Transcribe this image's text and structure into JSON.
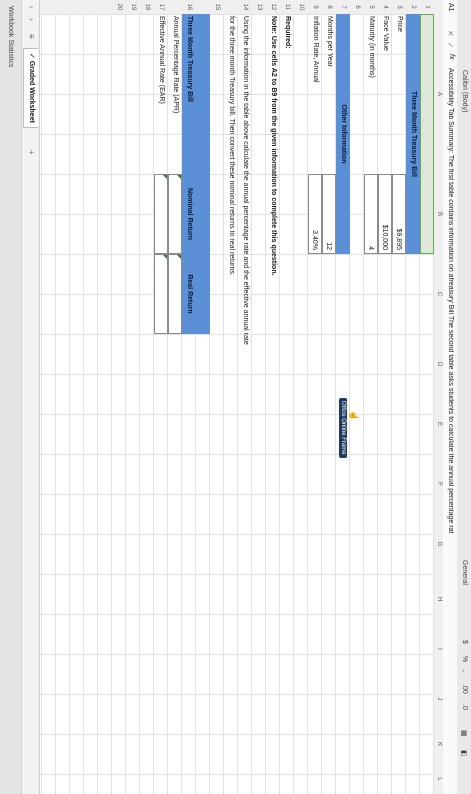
{
  "toolbar": {
    "font_name": "Calibri (Body)",
    "number_format": "General",
    "dollar": "$",
    "percent": "%",
    "comma": ",",
    "decimal_inc": ".00",
    "decimal_dec": ".0"
  },
  "formula_bar": {
    "cell_ref": "A1",
    "fx": "fx",
    "content": "Accessibility Tab Summary: The first table contains information on afreasury Bill The second table asks students to calculate the annual percentage rat"
  },
  "columns": [
    "A",
    "B",
    "C",
    "D",
    "E",
    "F",
    "G",
    "H",
    "I",
    "J",
    "K",
    "L"
  ],
  "rows": [
    "1",
    "2",
    "3",
    "4",
    "5",
    "6",
    "7",
    "8",
    "9",
    "10",
    "11",
    "12",
    "13",
    "14",
    "15",
    "16",
    "17",
    "18",
    "19",
    "20"
  ],
  "table1": {
    "title": "Three Month Treasury Bill",
    "rows": [
      {
        "label": "Price",
        "value": "$9,895"
      },
      {
        "label": "Face Value",
        "value": "$10,000"
      },
      {
        "label": "Maturity (in months)",
        "value": "4"
      }
    ]
  },
  "table2": {
    "title": "Other Information",
    "rows": [
      {
        "label": "Months per Year",
        "value": "12"
      },
      {
        "label": "Inflation Rate, Annual",
        "value": "3.40%"
      }
    ]
  },
  "required": {
    "heading": "Required:",
    "note": "Note: Use cells A2 to B9 from the given information to complete this question.",
    "instruction_line1": "Using the information in the table above calculate the annual percentage rate and the effective annual rate",
    "instruction_line2": "for the three month Treasury bill. Then convert these nominal returns to real returns."
  },
  "table3": {
    "title": "Three Month Treasury Bill",
    "col1": "Nominal Return",
    "col2": "Real Return",
    "rows": [
      {
        "label": "Annual Percentage Rate (APR)"
      },
      {
        "label": "Effective Annual Rate (EAR)"
      }
    ]
  },
  "popup": {
    "label": "Office Online Frame"
  },
  "tabs": {
    "active": "Graded Worksheet",
    "add": "+"
  },
  "status": {
    "text": "Workbook Statistics"
  }
}
